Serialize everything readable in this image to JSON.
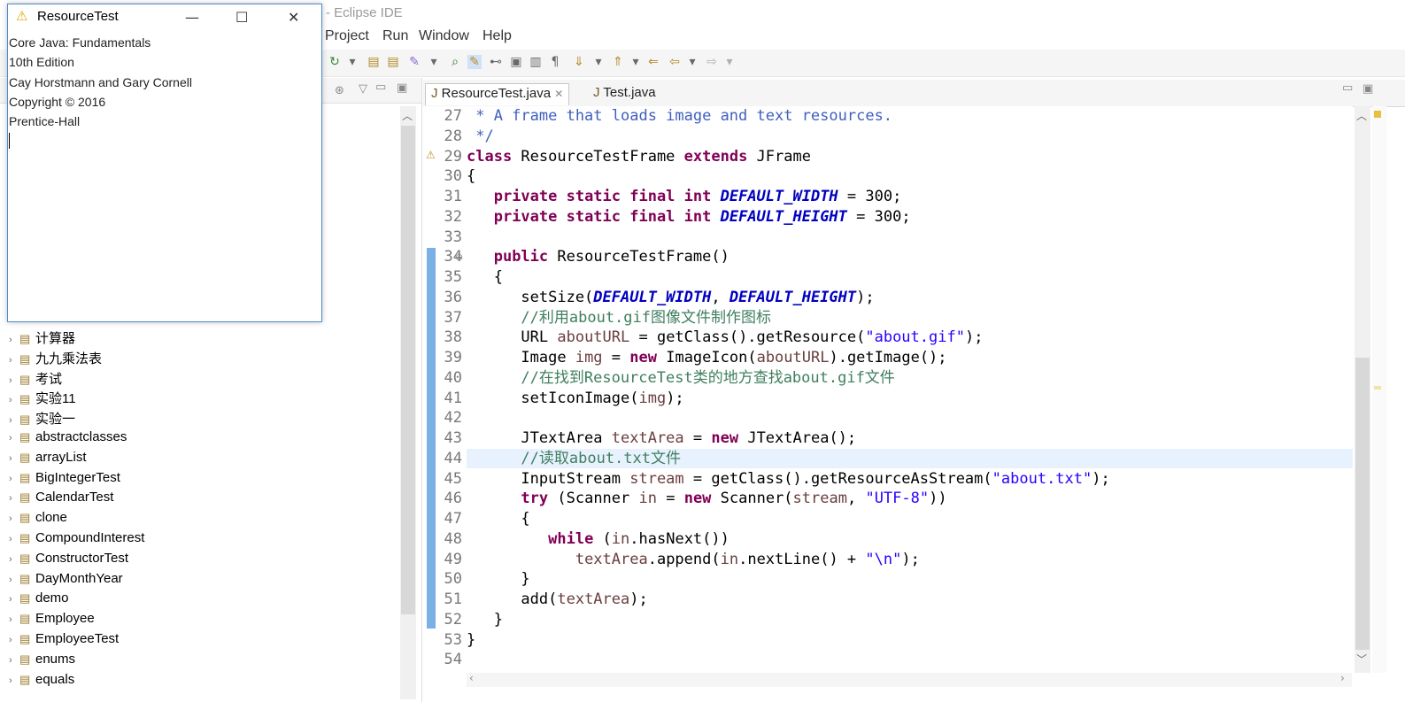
{
  "eclipse": {
    "title": "- Eclipse IDE",
    "menus": [
      "Project",
      "Run",
      "Window",
      "Help"
    ]
  },
  "package_explorer": {
    "items": [
      {
        "label": "计算器"
      },
      {
        "label": "九九乘法表"
      },
      {
        "label": "考试"
      },
      {
        "label": "实验11"
      },
      {
        "label": "实验一"
      },
      {
        "label": "abstractclasses"
      },
      {
        "label": "arrayList"
      },
      {
        "label": "BigIntegerTest"
      },
      {
        "label": "CalendarTest"
      },
      {
        "label": "clone"
      },
      {
        "label": "CompoundInterest"
      },
      {
        "label": "ConstructorTest"
      },
      {
        "label": "DayMonthYear"
      },
      {
        "label": "demo"
      },
      {
        "label": "Employee"
      },
      {
        "label": "EmployeeTest"
      },
      {
        "label": "enums"
      },
      {
        "label": "equals"
      }
    ]
  },
  "editor": {
    "tabs": [
      {
        "label": "ResourceTest.java",
        "active": true
      },
      {
        "label": "Test.java",
        "active": false
      }
    ],
    "current_line": 44,
    "lines": [
      {
        "n": "27",
        "segs": [
          [
            " * A frame that loads image and text resources.",
            "jd"
          ]
        ]
      },
      {
        "n": "28",
        "segs": [
          [
            " */",
            "jd"
          ]
        ]
      },
      {
        "n": "29",
        "segs": [
          [
            "class",
            "kw"
          ],
          [
            " ResourceTestFrame ",
            ""
          ],
          [
            "extends",
            "kw"
          ],
          [
            " JFrame",
            ""
          ]
        ]
      },
      {
        "n": "30",
        "segs": [
          [
            "{",
            ""
          ]
        ]
      },
      {
        "n": "31",
        "segs": [
          [
            "   ",
            ""
          ],
          [
            "private static final int",
            "kw"
          ],
          [
            " ",
            ""
          ],
          [
            "DEFAULT_WIDTH",
            "fld"
          ],
          [
            " = 300;",
            ""
          ]
        ]
      },
      {
        "n": "32",
        "segs": [
          [
            "   ",
            ""
          ],
          [
            "private static final int",
            "kw"
          ],
          [
            " ",
            ""
          ],
          [
            "DEFAULT_HEIGHT",
            "fld"
          ],
          [
            " = 300;",
            ""
          ]
        ]
      },
      {
        "n": "33",
        "segs": [
          [
            "",
            ""
          ]
        ]
      },
      {
        "n": "34",
        "segs": [
          [
            "   ",
            ""
          ],
          [
            "public",
            "kw"
          ],
          [
            " ResourceTestFrame()",
            ""
          ]
        ]
      },
      {
        "n": "35",
        "segs": [
          [
            "   {",
            ""
          ]
        ]
      },
      {
        "n": "36",
        "segs": [
          [
            "      setSize(",
            ""
          ],
          [
            "DEFAULT_WIDTH",
            "fld"
          ],
          [
            ", ",
            ""
          ],
          [
            "DEFAULT_HEIGHT",
            "fld"
          ],
          [
            ");",
            ""
          ]
        ]
      },
      {
        "n": "37",
        "segs": [
          [
            "      //利用about.gif图像文件制作图标",
            "cm"
          ]
        ]
      },
      {
        "n": "38",
        "segs": [
          [
            "      URL ",
            ""
          ],
          [
            "aboutURL",
            "var"
          ],
          [
            " = getClass().getResource(",
            ""
          ],
          [
            "\"about.gif\"",
            "st"
          ],
          [
            ");",
            ""
          ]
        ]
      },
      {
        "n": "39",
        "segs": [
          [
            "      Image ",
            ""
          ],
          [
            "img",
            "var"
          ],
          [
            " = ",
            ""
          ],
          [
            "new",
            "kw"
          ],
          [
            " ImageIcon(",
            ""
          ],
          [
            "aboutURL",
            "var"
          ],
          [
            ").getImage();",
            ""
          ]
        ]
      },
      {
        "n": "40",
        "segs": [
          [
            "      //在找到ResourceTest类的地方查找about.gif文件",
            "cm"
          ]
        ]
      },
      {
        "n": "41",
        "segs": [
          [
            "      setIconImage(",
            ""
          ],
          [
            "img",
            "var"
          ],
          [
            ");",
            ""
          ]
        ]
      },
      {
        "n": "42",
        "segs": [
          [
            "",
            ""
          ]
        ]
      },
      {
        "n": "43",
        "segs": [
          [
            "      JTextArea ",
            ""
          ],
          [
            "textArea",
            "var"
          ],
          [
            " = ",
            ""
          ],
          [
            "new",
            "kw"
          ],
          [
            " JTextArea();",
            ""
          ]
        ]
      },
      {
        "n": "44",
        "segs": [
          [
            "      //读取about.txt文件",
            "cm"
          ]
        ]
      },
      {
        "n": "45",
        "segs": [
          [
            "      InputStream ",
            ""
          ],
          [
            "stream",
            "var"
          ],
          [
            " = getClass().getResourceAsStream(",
            ""
          ],
          [
            "\"about.txt\"",
            "st"
          ],
          [
            ");",
            ""
          ]
        ]
      },
      {
        "n": "46",
        "segs": [
          [
            "      ",
            ""
          ],
          [
            "try",
            "kw"
          ],
          [
            " (Scanner ",
            ""
          ],
          [
            "in",
            "var"
          ],
          [
            " = ",
            ""
          ],
          [
            "new",
            "kw"
          ],
          [
            " Scanner(",
            ""
          ],
          [
            "stream",
            "var"
          ],
          [
            ", ",
            ""
          ],
          [
            "\"UTF-8\"",
            "st"
          ],
          [
            "))",
            ""
          ]
        ]
      },
      {
        "n": "47",
        "segs": [
          [
            "      {",
            ""
          ]
        ]
      },
      {
        "n": "48",
        "segs": [
          [
            "         ",
            ""
          ],
          [
            "while",
            "kw"
          ],
          [
            " (",
            ""
          ],
          [
            "in",
            "var"
          ],
          [
            ".hasNext())",
            ""
          ]
        ]
      },
      {
        "n": "49",
        "segs": [
          [
            "            ",
            ""
          ],
          [
            "textArea",
            "var"
          ],
          [
            ".append(",
            ""
          ],
          [
            "in",
            "var"
          ],
          [
            ".nextLine() + ",
            ""
          ],
          [
            "\"\\n\"",
            "st"
          ],
          [
            ");",
            ""
          ]
        ]
      },
      {
        "n": "50",
        "segs": [
          [
            "      }",
            ""
          ]
        ]
      },
      {
        "n": "51",
        "segs": [
          [
            "      add(",
            ""
          ],
          [
            "textArea",
            "var"
          ],
          [
            ");",
            ""
          ]
        ]
      },
      {
        "n": "52",
        "segs": [
          [
            "   }",
            ""
          ]
        ]
      },
      {
        "n": "53",
        "segs": [
          [
            "}",
            ""
          ]
        ]
      },
      {
        "n": "54",
        "segs": [
          [
            "",
            ""
          ]
        ]
      }
    ]
  },
  "resource_window": {
    "title": "ResourceTest",
    "lines": [
      "Core Java: Fundamentals",
      "10th Edition",
      "Cay Horstmann and Gary Cornell",
      "Copyright © 2016",
      "Prentice-Hall"
    ]
  },
  "colors": {
    "keyword": "#7f0055",
    "comment": "#3f7f5f",
    "javadoc": "#3f5fbf",
    "string": "#2a00ff",
    "field": "#0000c0",
    "variable": "#6a3e3e",
    "window_border": "#4a8ec9"
  }
}
